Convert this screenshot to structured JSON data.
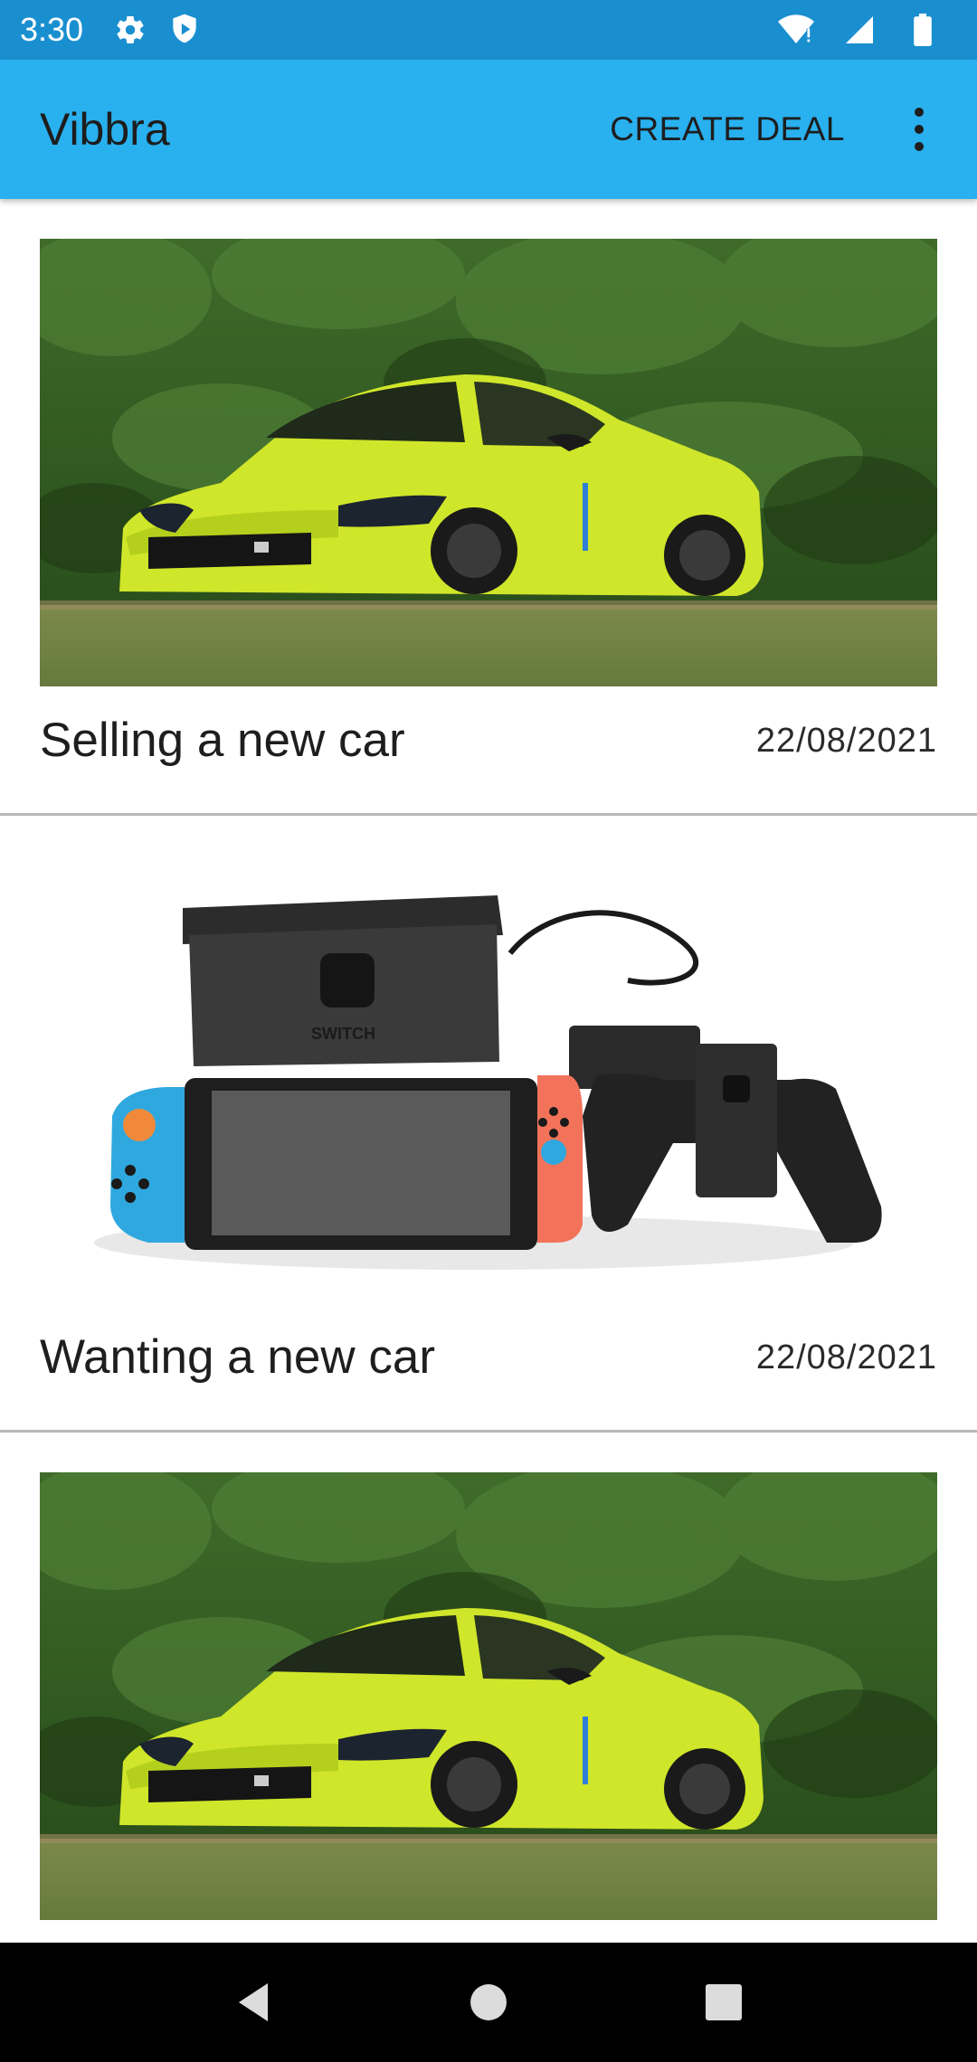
{
  "status_bar": {
    "time": "3:30",
    "icons_left": [
      "settings-icon",
      "shield-icon"
    ],
    "icons_right": [
      "wifi-icon",
      "signal-icon",
      "battery-icon"
    ]
  },
  "app_bar": {
    "title": "Vibbra",
    "action_label": "CREATE DEAL",
    "menu_icon": "more-vert-icon",
    "color": "#29b0ee"
  },
  "deals": [
    {
      "title": "Selling a new car",
      "date": "22/08/2021",
      "image": "yellow-car-photo"
    },
    {
      "title": "Wanting a new car",
      "date": "22/08/2021",
      "image": "nintendo-switch-photo"
    },
    {
      "title": "",
      "date": "",
      "image": "yellow-car-photo"
    }
  ],
  "nav_bar": {
    "buttons": [
      "back-icon",
      "home-icon",
      "recents-icon"
    ]
  }
}
